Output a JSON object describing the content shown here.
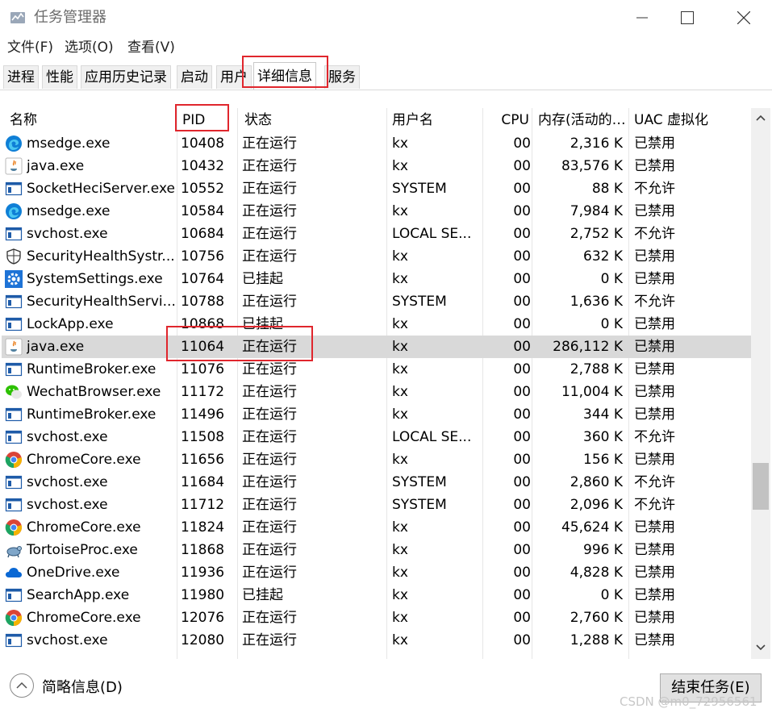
{
  "window": {
    "title": "任务管理器"
  },
  "menu": [
    "文件(F)",
    "选项(O)",
    "查看(V)"
  ],
  "tabs": [
    "进程",
    "性能",
    "应用历史记录",
    "启动",
    "用户",
    "详细信息",
    "服务"
  ],
  "columns": {
    "name": "名称",
    "pid": "PID",
    "status": "状态",
    "user": "用户名",
    "cpu": "CPU",
    "mem": "内存(活动的…",
    "uac": "UAC 虚拟化"
  },
  "rows": [
    {
      "icon": "edge",
      "name": "msedge.exe",
      "pid": "10408",
      "status": "正在运行",
      "user": "kx",
      "cpu": "00",
      "mem": "2,316 K",
      "uac": "已禁用"
    },
    {
      "icon": "java",
      "name": "java.exe",
      "pid": "10432",
      "status": "正在运行",
      "user": "kx",
      "cpu": "00",
      "mem": "83,576 K",
      "uac": "已禁用"
    },
    {
      "icon": "win",
      "name": "SocketHeciServer.exe",
      "pid": "10552",
      "status": "正在运行",
      "user": "SYSTEM",
      "cpu": "00",
      "mem": "88 K",
      "uac": "不允许"
    },
    {
      "icon": "edge",
      "name": "msedge.exe",
      "pid": "10584",
      "status": "正在运行",
      "user": "kx",
      "cpu": "00",
      "mem": "7,984 K",
      "uac": "已禁用"
    },
    {
      "icon": "win",
      "name": "svchost.exe",
      "pid": "10684",
      "status": "正在运行",
      "user": "LOCAL SE...",
      "cpu": "00",
      "mem": "2,752 K",
      "uac": "不允许"
    },
    {
      "icon": "shield",
      "name": "SecurityHealthSystr...",
      "pid": "10756",
      "status": "正在运行",
      "user": "kx",
      "cpu": "00",
      "mem": "632 K",
      "uac": "已禁用"
    },
    {
      "icon": "gear",
      "name": "SystemSettings.exe",
      "pid": "10764",
      "status": "已挂起",
      "user": "kx",
      "cpu": "00",
      "mem": "0 K",
      "uac": "已禁用"
    },
    {
      "icon": "win",
      "name": "SecurityHealthServi...",
      "pid": "10788",
      "status": "正在运行",
      "user": "SYSTEM",
      "cpu": "00",
      "mem": "1,636 K",
      "uac": "不允许"
    },
    {
      "icon": "win",
      "name": "LockApp.exe",
      "pid": "10868",
      "status": "已挂起",
      "user": "kx",
      "cpu": "00",
      "mem": "0 K",
      "uac": "已禁用"
    },
    {
      "icon": "java",
      "name": "java.exe",
      "pid": "11064",
      "status": "正在运行",
      "user": "kx",
      "cpu": "00",
      "mem": "286,112 K",
      "uac": "已禁用",
      "selected": true
    },
    {
      "icon": "win",
      "name": "RuntimeBroker.exe",
      "pid": "11076",
      "status": "正在运行",
      "user": "kx",
      "cpu": "00",
      "mem": "2,788 K",
      "uac": "已禁用"
    },
    {
      "icon": "wechat",
      "name": "WechatBrowser.exe",
      "pid": "11172",
      "status": "正在运行",
      "user": "kx",
      "cpu": "00",
      "mem": "11,004 K",
      "uac": "已禁用"
    },
    {
      "icon": "win",
      "name": "RuntimeBroker.exe",
      "pid": "11496",
      "status": "正在运行",
      "user": "kx",
      "cpu": "00",
      "mem": "344 K",
      "uac": "已禁用"
    },
    {
      "icon": "win",
      "name": "svchost.exe",
      "pid": "11508",
      "status": "正在运行",
      "user": "LOCAL SE...",
      "cpu": "00",
      "mem": "360 K",
      "uac": "不允许"
    },
    {
      "icon": "chrome",
      "name": "ChromeCore.exe",
      "pid": "11656",
      "status": "正在运行",
      "user": "kx",
      "cpu": "00",
      "mem": "156 K",
      "uac": "已禁用"
    },
    {
      "icon": "win",
      "name": "svchost.exe",
      "pid": "11684",
      "status": "正在运行",
      "user": "SYSTEM",
      "cpu": "00",
      "mem": "2,860 K",
      "uac": "不允许"
    },
    {
      "icon": "win",
      "name": "svchost.exe",
      "pid": "11712",
      "status": "正在运行",
      "user": "SYSTEM",
      "cpu": "00",
      "mem": "2,096 K",
      "uac": "不允许"
    },
    {
      "icon": "chrome",
      "name": "ChromeCore.exe",
      "pid": "11824",
      "status": "正在运行",
      "user": "kx",
      "cpu": "00",
      "mem": "45,624 K",
      "uac": "已禁用"
    },
    {
      "icon": "tortoise",
      "name": "TortoiseProc.exe",
      "pid": "11868",
      "status": "正在运行",
      "user": "kx",
      "cpu": "00",
      "mem": "996 K",
      "uac": "已禁用"
    },
    {
      "icon": "onedrive",
      "name": "OneDrive.exe",
      "pid": "11936",
      "status": "正在运行",
      "user": "kx",
      "cpu": "00",
      "mem": "4,828 K",
      "uac": "已禁用"
    },
    {
      "icon": "win",
      "name": "SearchApp.exe",
      "pid": "11980",
      "status": "已挂起",
      "user": "kx",
      "cpu": "00",
      "mem": "0 K",
      "uac": "已禁用"
    },
    {
      "icon": "chrome",
      "name": "ChromeCore.exe",
      "pid": "12076",
      "status": "正在运行",
      "user": "kx",
      "cpu": "00",
      "mem": "2,760 K",
      "uac": "已禁用"
    },
    {
      "icon": "win",
      "name": "svchost.exe",
      "pid": "12080",
      "status": "正在运行",
      "user": "kx",
      "cpu": "00",
      "mem": "1,288 K",
      "uac": "已禁用"
    }
  ],
  "footer": {
    "fewer_details": "简略信息(D)",
    "end_task": "结束任务(E)"
  },
  "watermark": "CSDN @m0_72956561",
  "colors": {
    "highlight": "#e0262d",
    "selected_row": "#d9d9d9",
    "edge": "#0f7fd6",
    "chrome": "#1da462"
  }
}
